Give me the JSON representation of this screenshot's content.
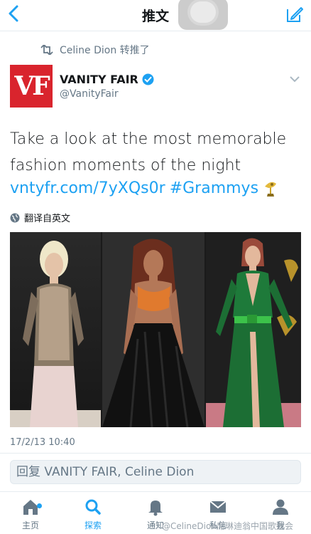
{
  "nav": {
    "title": "推文"
  },
  "retweet": {
    "text": "Celine Dion 转推了"
  },
  "author": {
    "avatar_text": "VF",
    "name": "VANITY FAIR",
    "handle": "@VanityFair"
  },
  "tweet": {
    "text": "Take a look at the most memorable fashion moments of the night",
    "link": "vntyfr.com/7yXQs0r",
    "hashtag": "#Grammys",
    "translate": "翻译自英文",
    "date": "17/2/13 10:40"
  },
  "reply": {
    "placeholder": "回复 VANITY FAIR, Celine Dion"
  },
  "tabs": [
    {
      "label": "主页"
    },
    {
      "label": "探索"
    },
    {
      "label": "通知"
    },
    {
      "label": "私信"
    },
    {
      "label": "我"
    }
  ],
  "watermark": "@CelineDion席琳迪翁中国歌迷会",
  "colors": {
    "accent": "#1da1f2",
    "avatar_bg": "#d9242d"
  }
}
